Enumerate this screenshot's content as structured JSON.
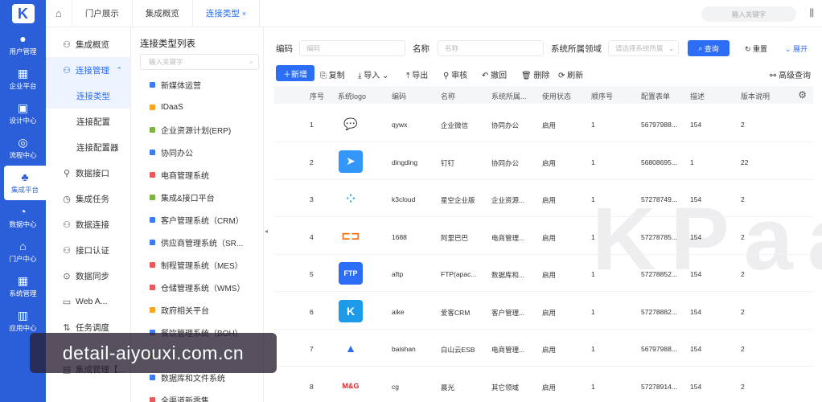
{
  "rail": [
    {
      "label": "用户管理",
      "icon": "user-icon"
    },
    {
      "label": "企业平台",
      "icon": "grid-icon"
    },
    {
      "label": "设计中心",
      "icon": "design-icon"
    },
    {
      "label": "流程中心",
      "icon": "flow-icon"
    },
    {
      "label": "集成平台",
      "icon": "integration-icon"
    },
    {
      "label": "数据中心",
      "icon": "pie-icon"
    },
    {
      "label": "门户中心",
      "icon": "portal-icon"
    },
    {
      "label": "系统管理",
      "icon": "settings-grid-icon"
    },
    {
      "label": "应用中心",
      "icon": "app-icon"
    }
  ],
  "tabs": [
    {
      "label": "门户展示"
    },
    {
      "label": "集成概览"
    },
    {
      "label": "连接类型"
    }
  ],
  "topsearch_placeholder": "输入关键字",
  "menu": {
    "overview": "集成概览",
    "connection": "连接管理",
    "sub": [
      "连接类型",
      "连接配置",
      "连接配置器"
    ],
    "items": [
      "数据接口",
      "集成任务",
      "数据连接",
      "接口认证",
      "数据同步",
      "Web A...",
      "任务调度",
      "集成管理【..."
    ]
  },
  "typelist": {
    "title": "连接类型列表",
    "search_placeholder": "输入关键字",
    "items": [
      {
        "label": "新媒体运营",
        "color": "#3b7df0"
      },
      {
        "label": "IDaaS",
        "color": "#f5a623"
      },
      {
        "label": "企业资源计划(ERP)",
        "color": "#7cb342"
      },
      {
        "label": "协同办公",
        "color": "#3b7df0"
      },
      {
        "label": "电商管理系统",
        "color": "#e85a5a"
      },
      {
        "label": "集成&接口平台",
        "color": "#7cb342"
      },
      {
        "label": "客户管理系统（CRM）",
        "color": "#3b7df0"
      },
      {
        "label": "供应商管理系统（SR...",
        "color": "#3b7df0"
      },
      {
        "label": "制程管理系统（MES）",
        "color": "#e85a5a"
      },
      {
        "label": "仓储管理系统（WMS）",
        "color": "#e85a5a"
      },
      {
        "label": "政府相关平台",
        "color": "#f5a623"
      },
      {
        "label": "餐饮管理系统（BOH）",
        "color": "#3b7df0"
      },
      {
        "label": "",
        "color": "#7cb342"
      },
      {
        "label": "数据库和文件系统",
        "color": "#3b7df0"
      },
      {
        "label": "全渠道新零售",
        "color": "#e85a5a"
      }
    ]
  },
  "filters": {
    "code_label": "编码",
    "code_placeholder": "编码",
    "name_label": "名称",
    "name_placeholder": "名称",
    "domain_label": "系统所属领域",
    "domain_placeholder": "请选择系统所属",
    "query": "查询",
    "reset": "重置",
    "expand": "展开"
  },
  "toolbar": {
    "new": "新增",
    "copy": "复制",
    "import": "导入",
    "export": "导出",
    "audit": "审核",
    "revoke": "撤回",
    "delete": "删除",
    "refresh": "刷新",
    "advanced": "高级查询"
  },
  "columns": [
    "序号",
    "系统logo",
    "编码",
    "名称",
    "系统所属...",
    "使用状态",
    "顺序号",
    "配置表单",
    "描述",
    "版本说明"
  ],
  "rows": [
    {
      "no": "1",
      "logo": "qywx-logo",
      "code": "qywx",
      "name": "企业微信",
      "domain": "协同办公",
      "status": "启用",
      "order": "1",
      "form": "56797988...",
      "desc": "154",
      "ver": "2"
    },
    {
      "no": "2",
      "logo": "dingding-logo",
      "code": "dingding",
      "name": "钉钉",
      "domain": "协同办公",
      "status": "启用",
      "order": "1",
      "form": "56808695...",
      "desc": "1",
      "ver": "22"
    },
    {
      "no": "3",
      "logo": "k3cloud-logo",
      "code": "k3cloud",
      "name": "星空企业版",
      "domain": "企业资源...",
      "status": "启用",
      "order": "1",
      "form": "57278749...",
      "desc": "154",
      "ver": "2"
    },
    {
      "no": "4",
      "logo": "1688-logo",
      "code": "1688",
      "name": "阿里巴巴",
      "domain": "电商管理...",
      "status": "启用",
      "order": "1",
      "form": "57278785...",
      "desc": "154",
      "ver": "2"
    },
    {
      "no": "5",
      "logo": "ftp-logo",
      "code": "aftp",
      "name": "FTP(apac...",
      "domain": "数据库和...",
      "status": "启用",
      "order": "1",
      "form": "57278852...",
      "desc": "154",
      "ver": "2"
    },
    {
      "no": "6",
      "logo": "aike-logo",
      "code": "aike",
      "name": "爱客CRM",
      "domain": "客户管理...",
      "status": "启用",
      "order": "1",
      "form": "57278882...",
      "desc": "154",
      "ver": "2"
    },
    {
      "no": "7",
      "logo": "baishan-logo",
      "code": "baishan",
      "name": "白山云ESB",
      "domain": "电商管理...",
      "status": "启用",
      "order": "1",
      "form": "56797988...",
      "desc": "154",
      "ver": "2"
    },
    {
      "no": "8",
      "logo": "cg-logo",
      "code": "cg",
      "name": "晨光",
      "domain": "其它领域",
      "status": "启用",
      "order": "1",
      "form": "57278914...",
      "desc": "154",
      "ver": "2"
    }
  ],
  "watermark": "KPaaS",
  "overlay": "detail-aiyouxi.com.cn"
}
